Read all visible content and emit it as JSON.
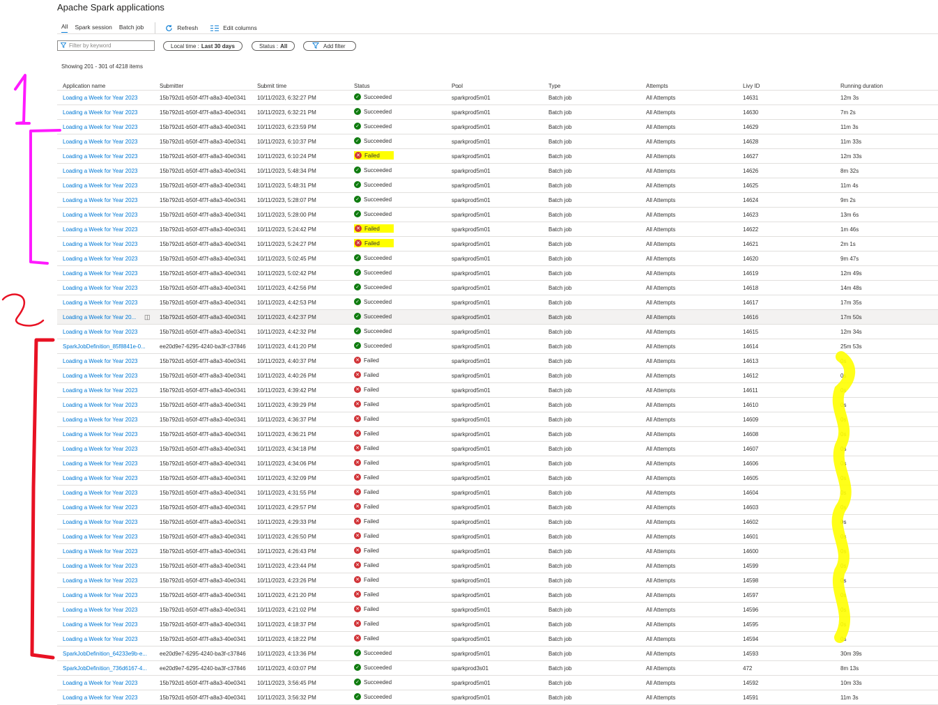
{
  "page": {
    "title": "Apache Spark applications",
    "tabs": [
      "All",
      "Spark session",
      "Batch job"
    ],
    "toolbar": {
      "refresh_label": "Refresh",
      "edit_columns_label": "Edit columns"
    },
    "filter": {
      "placeholder": "Filter by keyword"
    },
    "pills": {
      "time_label": "Local time :",
      "time_value": "Last 30 days",
      "status_label": "Status :",
      "status_value": "All",
      "add_filter_label": "Add filter"
    },
    "showing": "Showing 201 - 301 of 4218 items"
  },
  "columns": [
    "Application name",
    "Submitter",
    "Submit time",
    "Status",
    "Pool",
    "Type",
    "Attempts",
    "Livy ID",
    "Running duration"
  ],
  "colors": {
    "accent": "#0078d4",
    "success": "#107c10",
    "failure": "#d13438",
    "highlight": "#ffff00",
    "annotation_pink": "#ff1aff",
    "annotation_red": "#e81123"
  },
  "annotations": {
    "mark_1": "1",
    "mark_2": "2"
  },
  "rows": [
    {
      "name": "Loading a Week for Year 2023",
      "submitter": "15b792d1-b50f-4f7f-a8a3-40e0341",
      "time": "10/11/2023, 6:32:27 PM",
      "status": "Succeeded",
      "pool": "sparkprod5m01",
      "type": "Batch job",
      "attempts": "All Attempts",
      "livy": "14631",
      "duration": "12m 3s"
    },
    {
      "name": "Loading a Week for Year 2023",
      "submitter": "15b792d1-b50f-4f7f-a8a3-40e0341",
      "time": "10/11/2023, 6:32:21 PM",
      "status": "Succeeded",
      "pool": "sparkprod5m01",
      "type": "Batch job",
      "attempts": "All Attempts",
      "livy": "14630",
      "duration": "7m 2s"
    },
    {
      "name": "Loading a Week for Year 2023",
      "submitter": "15b792d1-b50f-4f7f-a8a3-40e0341",
      "time": "10/11/2023, 6:23:59 PM",
      "status": "Succeeded",
      "pool": "sparkprod5m01",
      "type": "Batch job",
      "attempts": "All Attempts",
      "livy": "14629",
      "duration": "11m 3s"
    },
    {
      "name": "Loading a Week for Year 2023",
      "submitter": "15b792d1-b50f-4f7f-a8a3-40e0341",
      "time": "10/11/2023, 6:10:37 PM",
      "status": "Succeeded",
      "pool": "sparkprod5m01",
      "type": "Batch job",
      "attempts": "All Attempts",
      "livy": "14628",
      "duration": "11m 33s"
    },
    {
      "name": "Loading a Week for Year 2023",
      "submitter": "15b792d1-b50f-4f7f-a8a3-40e0341",
      "time": "10/11/2023, 6:10:24 PM",
      "status": "Failed",
      "highlight": true,
      "pool": "sparkprod5m01",
      "type": "Batch job",
      "attempts": "All Attempts",
      "livy": "14627",
      "duration": "12m 33s"
    },
    {
      "name": "Loading a Week for Year 2023",
      "submitter": "15b792d1-b50f-4f7f-a8a3-40e0341",
      "time": "10/11/2023, 5:48:34 PM",
      "status": "Succeeded",
      "pool": "sparkprod5m01",
      "type": "Batch job",
      "attempts": "All Attempts",
      "livy": "14626",
      "duration": "8m 32s"
    },
    {
      "name": "Loading a Week for Year 2023",
      "submitter": "15b792d1-b50f-4f7f-a8a3-40e0341",
      "time": "10/11/2023, 5:48:31 PM",
      "status": "Succeeded",
      "pool": "sparkprod5m01",
      "type": "Batch job",
      "attempts": "All Attempts",
      "livy": "14625",
      "duration": "11m 4s"
    },
    {
      "name": "Loading a Week for Year 2023",
      "submitter": "15b792d1-b50f-4f7f-a8a3-40e0341",
      "time": "10/11/2023, 5:28:07 PM",
      "status": "Succeeded",
      "pool": "sparkprod5m01",
      "type": "Batch job",
      "attempts": "All Attempts",
      "livy": "14624",
      "duration": "9m 2s"
    },
    {
      "name": "Loading a Week for Year 2023",
      "submitter": "15b792d1-b50f-4f7f-a8a3-40e0341",
      "time": "10/11/2023, 5:28:00 PM",
      "status": "Succeeded",
      "pool": "sparkprod5m01",
      "type": "Batch job",
      "attempts": "All Attempts",
      "livy": "14623",
      "duration": "13m 6s"
    },
    {
      "name": "Loading a Week for Year 2023",
      "submitter": "15b792d1-b50f-4f7f-a8a3-40e0341",
      "time": "10/11/2023, 5:24:42 PM",
      "status": "Failed",
      "highlight": true,
      "pool": "sparkprod5m01",
      "type": "Batch job",
      "attempts": "All Attempts",
      "livy": "14622",
      "duration": "1m 46s"
    },
    {
      "name": "Loading a Week for Year 2023",
      "submitter": "15b792d1-b50f-4f7f-a8a3-40e0341",
      "time": "10/11/2023, 5:24:27 PM",
      "status": "Failed",
      "highlight": true,
      "pool": "sparkprod5m01",
      "type": "Batch job",
      "attempts": "All Attempts",
      "livy": "14621",
      "duration": "2m 1s"
    },
    {
      "name": "Loading a Week for Year 2023",
      "submitter": "15b792d1-b50f-4f7f-a8a3-40e0341",
      "time": "10/11/2023, 5:02:45 PM",
      "status": "Succeeded",
      "pool": "sparkprod5m01",
      "type": "Batch job",
      "attempts": "All Attempts",
      "livy": "14620",
      "duration": "9m 47s"
    },
    {
      "name": "Loading a Week for Year 2023",
      "submitter": "15b792d1-b50f-4f7f-a8a3-40e0341",
      "time": "10/11/2023, 5:02:42 PM",
      "status": "Succeeded",
      "pool": "sparkprod5m01",
      "type": "Batch job",
      "attempts": "All Attempts",
      "livy": "14619",
      "duration": "12m 49s"
    },
    {
      "name": "Loading a Week for Year 2023",
      "submitter": "15b792d1-b50f-4f7f-a8a3-40e0341",
      "time": "10/11/2023, 4:42:56 PM",
      "status": "Succeeded",
      "pool": "sparkprod5m01",
      "type": "Batch job",
      "attempts": "All Attempts",
      "livy": "14618",
      "duration": "14m 48s"
    },
    {
      "name": "Loading a Week for Year 2023",
      "submitter": "15b792d1-b50f-4f7f-a8a3-40e0341",
      "time": "10/11/2023, 4:42:53 PM",
      "status": "Succeeded",
      "pool": "sparkprod5m01",
      "type": "Batch job",
      "attempts": "All Attempts",
      "livy": "14617",
      "duration": "17m 35s"
    },
    {
      "name": "Loading a Week for Year 20...",
      "submitter": "15b792d1-b50f-4f7f-a8a3-40e0341",
      "time": "10/11/2023, 4:42:37 PM",
      "status": "Succeeded",
      "hover": true,
      "pool": "sparkprod5m01",
      "type": "Batch job",
      "attempts": "All Attempts",
      "livy": "14616",
      "duration": "17m 50s"
    },
    {
      "name": "Loading a Week for Year 2023",
      "submitter": "15b792d1-b50f-4f7f-a8a3-40e0341",
      "time": "10/11/2023, 4:42:32 PM",
      "status": "Succeeded",
      "pool": "sparkprod5m01",
      "type": "Batch job",
      "attempts": "All Attempts",
      "livy": "14615",
      "duration": "12m 34s"
    },
    {
      "name": "SparkJobDefinition_85f8841e-0...",
      "submitter": "ee20d9e7-6295-4240-ba3f-c37846",
      "time": "10/11/2023, 4:41:20 PM",
      "status": "Succeeded",
      "pool": "sparkprod5m01",
      "type": "Batch job",
      "attempts": "All Attempts",
      "livy": "14614",
      "duration": "25m 53s"
    },
    {
      "name": "Loading a Week for Year 2023",
      "submitter": "15b792d1-b50f-4f7f-a8a3-40e0341",
      "time": "10/11/2023, 4:40:37 PM",
      "status": "Failed",
      "pool": "sparkprod5m01",
      "type": "Batch job",
      "attempts": "All Attempts",
      "livy": "14613",
      "duration": "0s"
    },
    {
      "name": "Loading a Week for Year 2023",
      "submitter": "15b792d1-b50f-4f7f-a8a3-40e0341",
      "time": "10/11/2023, 4:40:26 PM",
      "status": "Failed",
      "pool": "sparkprod5m01",
      "type": "Batch job",
      "attempts": "All Attempts",
      "livy": "14612",
      "duration": "0s"
    },
    {
      "name": "Loading a Week for Year 2023",
      "submitter": "15b792d1-b50f-4f7f-a8a3-40e0341",
      "time": "10/11/2023, 4:39:42 PM",
      "status": "Failed",
      "pool": "sparkprod5m01",
      "type": "Batch job",
      "attempts": "All Attempts",
      "livy": "14611",
      "duration": "0s"
    },
    {
      "name": "Loading a Week for Year 2023",
      "submitter": "15b792d1-b50f-4f7f-a8a3-40e0341",
      "time": "10/11/2023, 4:39:29 PM",
      "status": "Failed",
      "pool": "sparkprod5m01",
      "type": "Batch job",
      "attempts": "All Attempts",
      "livy": "14610",
      "duration": "0s"
    },
    {
      "name": "Loading a Week for Year 2023",
      "submitter": "15b792d1-b50f-4f7f-a8a3-40e0341",
      "time": "10/11/2023, 4:36:37 PM",
      "status": "Failed",
      "pool": "sparkprod5m01",
      "type": "Batch job",
      "attempts": "All Attempts",
      "livy": "14609",
      "duration": "0s"
    },
    {
      "name": "Loading a Week for Year 2023",
      "submitter": "15b792d1-b50f-4f7f-a8a3-40e0341",
      "time": "10/11/2023, 4:36:21 PM",
      "status": "Failed",
      "pool": "sparkprod5m01",
      "type": "Batch job",
      "attempts": "All Attempts",
      "livy": "14608",
      "duration": "0s"
    },
    {
      "name": "Loading a Week for Year 2023",
      "submitter": "15b792d1-b50f-4f7f-a8a3-40e0341",
      "time": "10/11/2023, 4:34:18 PM",
      "status": "Failed",
      "pool": "sparkprod5m01",
      "type": "Batch job",
      "attempts": "All Attempts",
      "livy": "14607",
      "duration": "0s"
    },
    {
      "name": "Loading a Week for Year 2023",
      "submitter": "15b792d1-b50f-4f7f-a8a3-40e0341",
      "time": "10/11/2023, 4:34:06 PM",
      "status": "Failed",
      "pool": "sparkprod5m01",
      "type": "Batch job",
      "attempts": "All Attempts",
      "livy": "14606",
      "duration": "0s"
    },
    {
      "name": "Loading a Week for Year 2023",
      "submitter": "15b792d1-b50f-4f7f-a8a3-40e0341",
      "time": "10/11/2023, 4:32:09 PM",
      "status": "Failed",
      "pool": "sparkprod5m01",
      "type": "Batch job",
      "attempts": "All Attempts",
      "livy": "14605",
      "duration": "0s"
    },
    {
      "name": "Loading a Week for Year 2023",
      "submitter": "15b792d1-b50f-4f7f-a8a3-40e0341",
      "time": "10/11/2023, 4:31:55 PM",
      "status": "Failed",
      "pool": "sparkprod5m01",
      "type": "Batch job",
      "attempts": "All Attempts",
      "livy": "14604",
      "duration": "0s"
    },
    {
      "name": "Loading a Week for Year 2023",
      "submitter": "15b792d1-b50f-4f7f-a8a3-40e0341",
      "time": "10/11/2023, 4:29:57 PM",
      "status": "Failed",
      "pool": "sparkprod5m01",
      "type": "Batch job",
      "attempts": "All Attempts",
      "livy": "14603",
      "duration": "0s"
    },
    {
      "name": "Loading a Week for Year 2023",
      "submitter": "15b792d1-b50f-4f7f-a8a3-40e0341",
      "time": "10/11/2023, 4:29:33 PM",
      "status": "Failed",
      "pool": "sparkprod5m01",
      "type": "Batch job",
      "attempts": "All Attempts",
      "livy": "14602",
      "duration": "0s"
    },
    {
      "name": "Loading a Week for Year 2023",
      "submitter": "15b792d1-b50f-4f7f-a8a3-40e0341",
      "time": "10/11/2023, 4:26:50 PM",
      "status": "Failed",
      "pool": "sparkprod5m01",
      "type": "Batch job",
      "attempts": "All Attempts",
      "livy": "14601",
      "duration": "0s"
    },
    {
      "name": "Loading a Week for Year 2023",
      "submitter": "15b792d1-b50f-4f7f-a8a3-40e0341",
      "time": "10/11/2023, 4:26:43 PM",
      "status": "Failed",
      "pool": "sparkprod5m01",
      "type": "Batch job",
      "attempts": "All Attempts",
      "livy": "14600",
      "duration": "0s"
    },
    {
      "name": "Loading a Week for Year 2023",
      "submitter": "15b792d1-b50f-4f7f-a8a3-40e0341",
      "time": "10/11/2023, 4:23:44 PM",
      "status": "Failed",
      "pool": "sparkprod5m01",
      "type": "Batch job",
      "attempts": "All Attempts",
      "livy": "14599",
      "duration": "0s"
    },
    {
      "name": "Loading a Week for Year 2023",
      "submitter": "15b792d1-b50f-4f7f-a8a3-40e0341",
      "time": "10/11/2023, 4:23:26 PM",
      "status": "Failed",
      "pool": "sparkprod5m01",
      "type": "Batch job",
      "attempts": "All Attempts",
      "livy": "14598",
      "duration": "0s"
    },
    {
      "name": "Loading a Week for Year 2023",
      "submitter": "15b792d1-b50f-4f7f-a8a3-40e0341",
      "time": "10/11/2023, 4:21:20 PM",
      "status": "Failed",
      "pool": "sparkprod5m01",
      "type": "Batch job",
      "attempts": "All Attempts",
      "livy": "14597",
      "duration": "0s"
    },
    {
      "name": "Loading a Week for Year 2023",
      "submitter": "15b792d1-b50f-4f7f-a8a3-40e0341",
      "time": "10/11/2023, 4:21:02 PM",
      "status": "Failed",
      "pool": "sparkprod5m01",
      "type": "Batch job",
      "attempts": "All Attempts",
      "livy": "14596",
      "duration": "0s"
    },
    {
      "name": "Loading a Week for Year 2023",
      "submitter": "15b792d1-b50f-4f7f-a8a3-40e0341",
      "time": "10/11/2023, 4:18:37 PM",
      "status": "Failed",
      "pool": "sparkprod5m01",
      "type": "Batch job",
      "attempts": "All Attempts",
      "livy": "14595",
      "duration": "0s"
    },
    {
      "name": "Loading a Week for Year 2023",
      "submitter": "15b792d1-b50f-4f7f-a8a3-40e0341",
      "time": "10/11/2023, 4:18:22 PM",
      "status": "Failed",
      "pool": "sparkprod5m01",
      "type": "Batch job",
      "attempts": "All Attempts",
      "livy": "14594",
      "duration": "0s"
    },
    {
      "name": "SparkJobDefinition_64233e9b-e...",
      "submitter": "ee20d9e7-6295-4240-ba3f-c37846",
      "time": "10/11/2023, 4:13:36 PM",
      "status": "Succeeded",
      "pool": "sparkprod5m01",
      "type": "Batch job",
      "attempts": "All Attempts",
      "livy": "14593",
      "duration": "30m 39s"
    },
    {
      "name": "SparkJobDefinition_736d6167-4...",
      "submitter": "ee20d9e7-6295-4240-ba3f-c37846",
      "time": "10/11/2023, 4:03:07 PM",
      "status": "Succeeded",
      "pool": "sparkprod3s01",
      "type": "Batch job",
      "attempts": "All Attempts",
      "livy": "472",
      "duration": "8m 13s"
    },
    {
      "name": "Loading a Week for Year 2023",
      "submitter": "15b792d1-b50f-4f7f-a8a3-40e0341",
      "time": "10/11/2023, 3:56:45 PM",
      "status": "Succeeded",
      "pool": "sparkprod5m01",
      "type": "Batch job",
      "attempts": "All Attempts",
      "livy": "14592",
      "duration": "10m 33s"
    },
    {
      "name": "Loading a Week for Year 2023",
      "submitter": "15b792d1-b50f-4f7f-a8a3-40e0341",
      "time": "10/11/2023, 3:56:32 PM",
      "status": "Succeeded",
      "pool": "sparkprod5m01",
      "type": "Batch job",
      "attempts": "All Attempts",
      "livy": "14591",
      "duration": "11m 3s"
    }
  ]
}
